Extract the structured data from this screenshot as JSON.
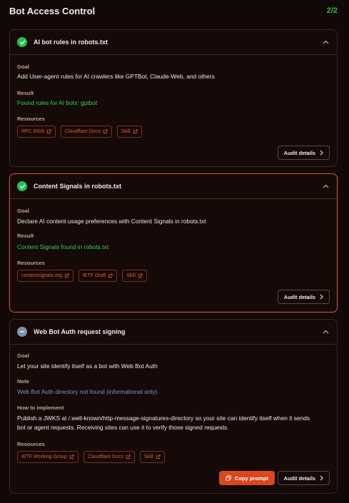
{
  "header": {
    "title": "Bot Access Control",
    "count": "2/2"
  },
  "labels": {
    "goal": "Goal",
    "result": "Result",
    "resources": "Resources",
    "note": "Note",
    "how": "How to implement"
  },
  "cards": [
    {
      "title": "AI bot rules in robots.txt",
      "status": "pass",
      "goal": "Add User-agent rules for AI crawlers like GPTBot, Claude-Web, and others",
      "result": "Found rules for AI bots: gptbot",
      "resources": [
        "RFC 9309",
        "Cloudflare Docs",
        "Skill"
      ],
      "audit_label": "Audit details"
    },
    {
      "title": "Content Signals in robots.txt",
      "status": "pass",
      "goal": "Declare AI content usage preferences with Content Signals in robots.txt",
      "result": "Content Signals found in robots.txt",
      "resources": [
        "contentsignals.org",
        "IETF Draft",
        "Skill"
      ],
      "audit_label": "Audit details"
    },
    {
      "title": "Web Bot Auth request signing",
      "status": "neutral",
      "goal": "Let your site identify itself as a bot with Web Bot Auth",
      "note": "Web Bot Auth directory not found (informational only)",
      "how_line1": "Publish a JWKS at /.well-known/http-message-signatures-directory so your site can identify itself when it sends",
      "how_line2": "bot or agent requests. Receiving sites can use it to verify those signed requests.",
      "resources": [
        "IETF Working Group",
        "Cloudflare Docs",
        "Skill"
      ],
      "copy_label": "Copy prompt",
      "audit_label": "Audit details"
    }
  ],
  "colors": {
    "accent": "#e0572d",
    "pass": "#27c04e",
    "neutral": "#8290a6",
    "note": "#7e93b8"
  }
}
